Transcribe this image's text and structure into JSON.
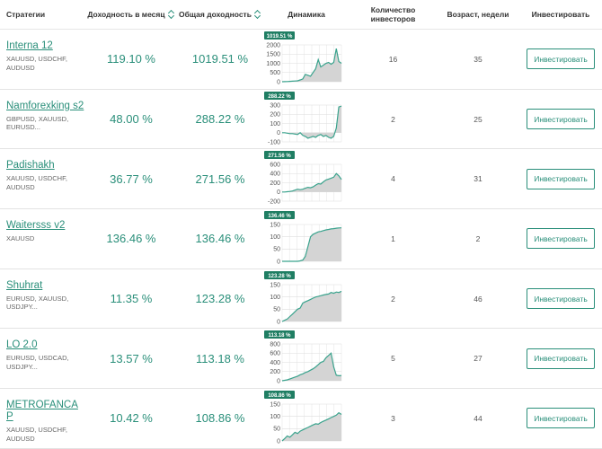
{
  "header": {
    "strategies": "Стратегии",
    "monthly": "Доходность в месяц",
    "total": "Общая доходность",
    "dynamics": "Динамика",
    "investors": "Количество инвесторов",
    "age": "Возраст, недели",
    "invest": "Инвестировать"
  },
  "rows": [
    {
      "name": "Interna 12",
      "symbols": [
        "XAUUSD, USDCHF,",
        "AUDUSD"
      ],
      "monthly": "119.10 %",
      "total": "1019.51 %",
      "investors": "16",
      "age": "35",
      "button": "Инвестировать",
      "chart": {
        "badge": "1019.51 %",
        "ticks": [
          "2000",
          "1500",
          "1000",
          "500",
          "0"
        ],
        "ymin": 0,
        "ymax": 2000,
        "points": [
          0,
          5,
          10,
          20,
          30,
          40,
          50,
          100,
          150,
          400,
          350,
          300,
          500,
          700,
          1200,
          800,
          900,
          1000,
          1050,
          950,
          1050,
          1800,
          1100,
          1000
        ]
      }
    },
    {
      "name": "Namforexking s2",
      "symbols": [
        "GBPUSD, XAUUSD,",
        "EURUSD..."
      ],
      "monthly": "48.00 %",
      "total": "288.22 %",
      "investors": "2",
      "age": "25",
      "button": "Инвестировать",
      "chart": {
        "badge": "288.22 %",
        "ticks": [
          "300",
          "200",
          "100",
          "0",
          "-100"
        ],
        "ymin": -100,
        "ymax": 300,
        "points": [
          0,
          0,
          -5,
          -10,
          -10,
          -15,
          -20,
          0,
          -30,
          -40,
          -60,
          -50,
          -40,
          -50,
          -30,
          -20,
          -40,
          -30,
          -50,
          -60,
          -40,
          50,
          280,
          288
        ]
      }
    },
    {
      "name": "Padishakh",
      "symbols": [
        "XAUUSD, USDCHF,",
        "AUDUSD"
      ],
      "monthly": "36.77 %",
      "total": "271.56 %",
      "investors": "4",
      "age": "31",
      "button": "Инвестировать",
      "chart": {
        "badge": "271.56 %",
        "ticks": [
          "600",
          "400",
          "200",
          "0",
          "-200"
        ],
        "ymin": -200,
        "ymax": 600,
        "points": [
          0,
          0,
          5,
          10,
          20,
          40,
          60,
          50,
          60,
          80,
          100,
          90,
          110,
          150,
          180,
          170,
          220,
          260,
          280,
          300,
          320,
          400,
          350,
          271
        ]
      }
    },
    {
      "name": "Waitersss v2",
      "symbols": [
        "XAUUSD"
      ],
      "monthly": "136.46 %",
      "total": "136.46 %",
      "investors": "1",
      "age": "2",
      "button": "Инвестировать",
      "chart": {
        "badge": "136.46 %",
        "ticks": [
          "150",
          "100",
          "50",
          "0"
        ],
        "ymin": 0,
        "ymax": 150,
        "points": [
          0,
          0,
          0,
          0,
          0,
          0,
          0,
          2,
          5,
          20,
          60,
          100,
          110,
          115,
          120,
          122,
          125,
          128,
          130,
          132,
          133,
          135,
          136,
          136.46
        ]
      }
    },
    {
      "name": "Shuhrat",
      "symbols": [
        "EURUSD, XAUUSD,",
        "USDJPY..."
      ],
      "monthly": "11.35 %",
      "total": "123.28 %",
      "investors": "2",
      "age": "46",
      "button": "Инвестировать",
      "chart": {
        "badge": "123.28 %",
        "ticks": [
          "150",
          "100",
          "50",
          "0"
        ],
        "ymin": 0,
        "ymax": 150,
        "points": [
          0,
          5,
          10,
          20,
          30,
          40,
          50,
          55,
          75,
          80,
          85,
          90,
          95,
          100,
          102,
          105,
          108,
          110,
          112,
          118,
          115,
          120,
          118,
          123
        ]
      }
    },
    {
      "name": "LO 2.0",
      "symbols": [
        "EURUSD, USDCAD,",
        "USDJPY..."
      ],
      "monthly": "13.57 %",
      "total": "113.18 %",
      "investors": "5",
      "age": "27",
      "button": "Инвестировать",
      "chart": {
        "badge": "113.18 %",
        "ticks": [
          "800",
          "600",
          "400",
          "200",
          "0"
        ],
        "ymin": 0,
        "ymax": 800,
        "points": [
          0,
          10,
          20,
          40,
          60,
          80,
          100,
          130,
          150,
          180,
          200,
          230,
          260,
          300,
          350,
          400,
          420,
          500,
          550,
          600,
          300,
          120,
          110,
          113
        ]
      }
    },
    {
      "name": "METROFANCA P",
      "symbols": [
        "XAUUSD, USDCHF,",
        "AUDUSD"
      ],
      "monthly": "10.42 %",
      "total": "108.86 %",
      "investors": "3",
      "age": "44",
      "button": "Инвестировать",
      "chart": {
        "badge": "108.86 %",
        "ticks": [
          "150",
          "100",
          "50",
          "0"
        ],
        "ymin": 0,
        "ymax": 150,
        "points": [
          0,
          10,
          20,
          15,
          25,
          35,
          30,
          40,
          45,
          50,
          55,
          60,
          65,
          70,
          68,
          75,
          80,
          85,
          90,
          95,
          100,
          105,
          115,
          108
        ]
      }
    }
  ],
  "colors": {
    "accent": "#2a8f7a",
    "badge": "#1f7e63",
    "area": "#d4d4d4"
  }
}
